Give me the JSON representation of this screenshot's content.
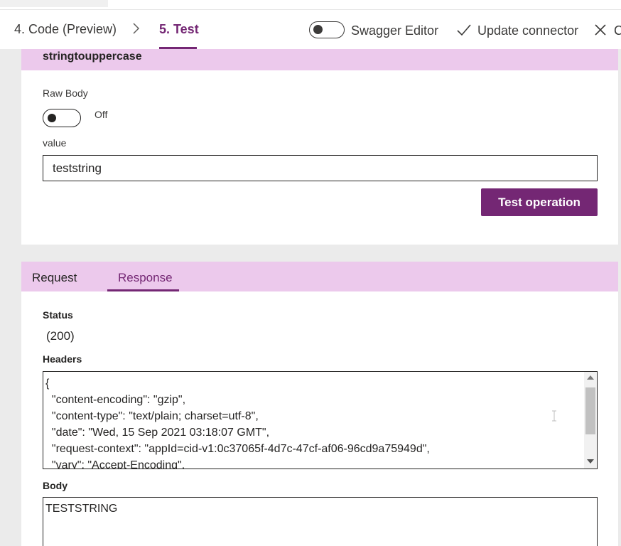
{
  "nav": {
    "steps": [
      {
        "label": "4. Code (Preview)"
      },
      {
        "label": "5. Test"
      }
    ],
    "swagger_label": "Swagger Editor",
    "update_label": "Update connector",
    "close_label": "C"
  },
  "operation": {
    "title": "stringtouppercase",
    "raw_body_label": "Raw Body",
    "raw_body_state": "Off",
    "value_label": "value",
    "value": "teststring",
    "test_button": "Test operation"
  },
  "response": {
    "tabs": [
      {
        "label": "Request"
      },
      {
        "label": "Response"
      }
    ],
    "status_label": "Status",
    "status_value": "(200)",
    "headers_label": "Headers",
    "headers_lines": [
      "{",
      "  \"content-encoding\": \"gzip\",",
      "  \"content-type\": \"text/plain; charset=utf-8\",",
      "  \"date\": \"Wed, 15 Sep 2021 03:18:07 GMT\",",
      "  \"request-context\": \"appId=cid-v1:0c37065f-4d7c-47cf-af06-96cd9a75949d\",",
      "  \"vary\": \"Accept-Encoding\","
    ],
    "body_label": "Body",
    "body_value": "TESTSTRING"
  },
  "colors": {
    "accent": "#742774",
    "header_band": "#ecc9ec",
    "page_bg": "#ebebeb"
  },
  "icons": {
    "step_separator": "chevron-right-icon",
    "update": "checkmark-icon",
    "close": "close-icon"
  }
}
